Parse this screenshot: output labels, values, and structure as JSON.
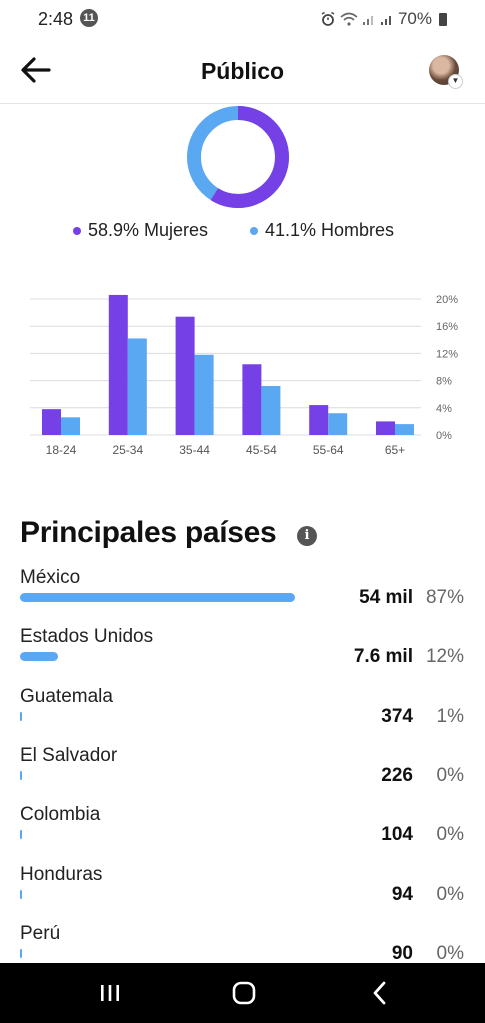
{
  "status_bar": {
    "time": "2:48",
    "notification_count": "11",
    "battery": "70%"
  },
  "header": {
    "title": "Público",
    "back_icon": "back-arrow-icon",
    "avatar_icon": "profile-avatar"
  },
  "gender": {
    "women_label": "58.9% Mujeres",
    "men_label": "41.1% Hombres",
    "women_value": 58.9,
    "men_value": 41.1,
    "women_color": "#7540e6",
    "men_color": "#5aa7f2"
  },
  "chart_data": {
    "type": "bar",
    "categories": [
      "18-24",
      "25-34",
      "35-44",
      "45-54",
      "55-64",
      "65+"
    ],
    "series": [
      {
        "name": "Mujeres",
        "color": "#7540e6",
        "values": [
          3.8,
          20.6,
          17.4,
          10.4,
          4.4,
          2.0
        ]
      },
      {
        "name": "Hombres",
        "color": "#5aa7f2",
        "values": [
          2.6,
          14.2,
          11.8,
          7.2,
          3.2,
          1.6
        ]
      }
    ],
    "ylim": [
      0,
      20
    ],
    "yticks": [
      "20%",
      "16%",
      "12%",
      "8%",
      "4%",
      "0%"
    ],
    "ytick_values": [
      20,
      16,
      12,
      8,
      4,
      0
    ],
    "grid": true,
    "axis_position": "right"
  },
  "countries": {
    "title": "Principales países",
    "rows": [
      {
        "name": "México",
        "count": "54 mil",
        "pct": "87%",
        "share": 87
      },
      {
        "name": "Estados Unidos",
        "count": "7.6 mil",
        "pct": "12%",
        "share": 12
      },
      {
        "name": "Guatemala",
        "count": "374",
        "pct": "1%",
        "share": 0.6
      },
      {
        "name": "El Salvador",
        "count": "226",
        "pct": "0%",
        "share": 0.4
      },
      {
        "name": "Colombia",
        "count": "104",
        "pct": "0%",
        "share": 0.2
      },
      {
        "name": "Honduras",
        "count": "94",
        "pct": "0%",
        "share": 0.15
      },
      {
        "name": "Perú",
        "count": "90",
        "pct": "0%",
        "share": 0.14
      }
    ]
  },
  "nav_bar": {
    "recents_icon": "recent-apps-icon",
    "home_icon": "home-icon",
    "back_icon": "nav-back-icon"
  }
}
